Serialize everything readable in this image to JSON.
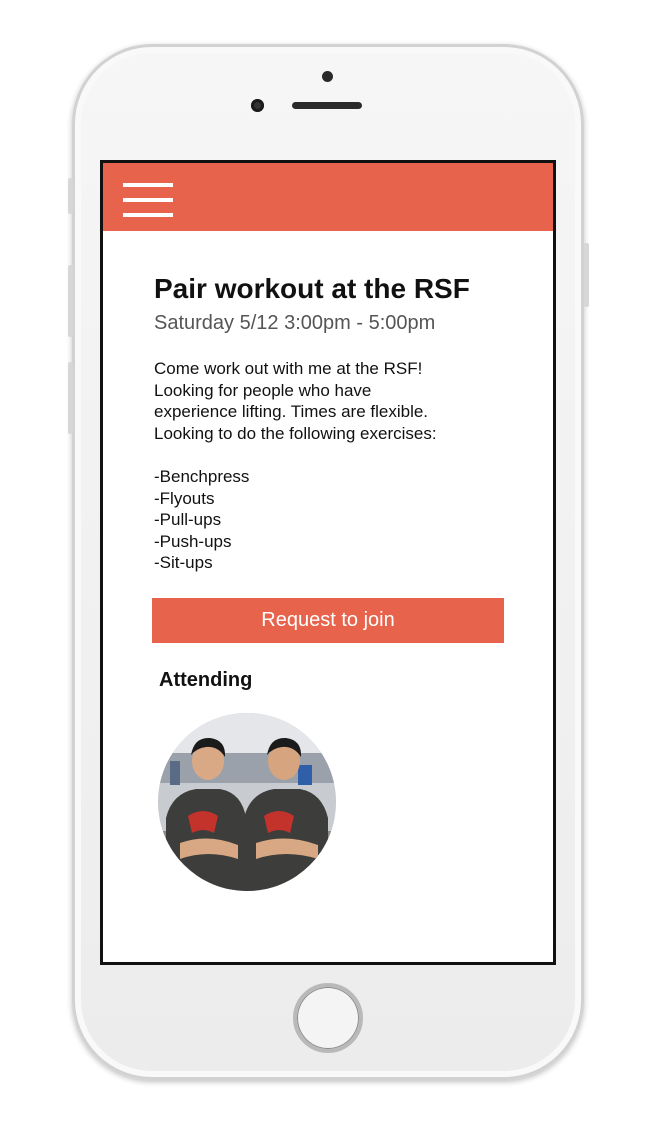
{
  "event": {
    "title": "Pair workout at the RSF",
    "datetime": "Saturday 5/12 3:00pm - 5:00pm",
    "description_lines": [
      "Come work out with me at the RSF!",
      "Looking for people who have",
      "experience lifting. Times are flexible.",
      "Looking to do the following exercises:"
    ],
    "exercises": [
      "-Benchpress",
      "-Flyouts",
      "-Pull-ups",
      "-Push-ups",
      "-Sit-ups"
    ]
  },
  "actions": {
    "join_label": "Request to join"
  },
  "attending": {
    "heading": "Attending"
  },
  "colors": {
    "accent": "#e8634c",
    "screen_border": "#111111",
    "shirt": "#3d3e3c",
    "shirt_print": "#c4322c"
  },
  "icons": {
    "menu": "hamburger-menu-icon"
  }
}
